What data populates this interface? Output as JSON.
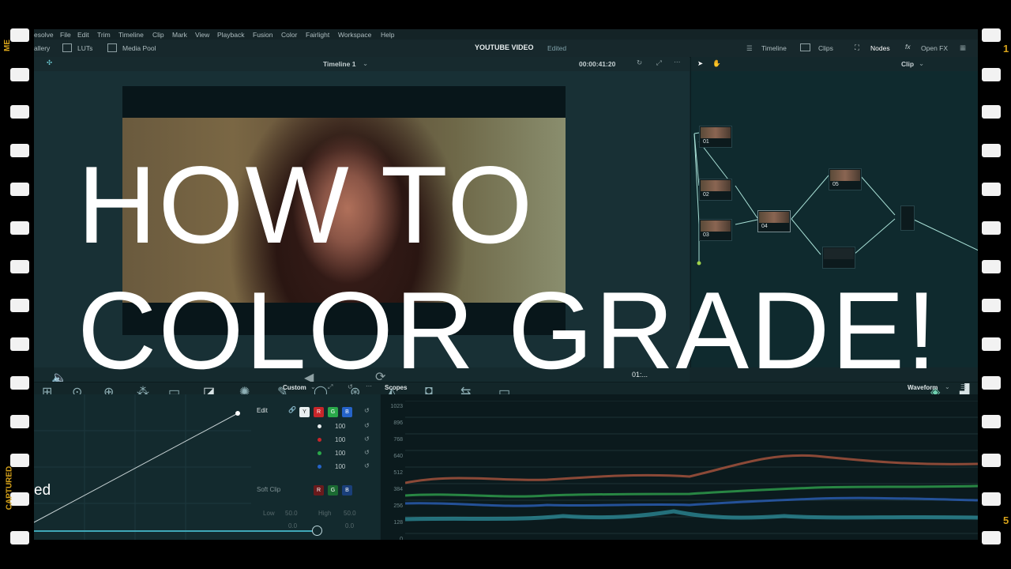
{
  "overlay": {
    "line1": "HOW TO",
    "line2": "COLOR GRADE!",
    "fragment": "ed"
  },
  "filmstrip": {
    "left_top": "ME",
    "left_bottom": "CAPTURED",
    "right_top": "1",
    "right_bottom": "5"
  },
  "menu": [
    "esolve",
    "File",
    "Edit",
    "Trim",
    "Timeline",
    "Clip",
    "Mark",
    "View",
    "Playback",
    "Fusion",
    "Color",
    "Fairlight",
    "Workspace",
    "Help"
  ],
  "toolbar": {
    "gallery": "allery",
    "luts": "LUTs",
    "media_pool": "Media Pool",
    "project_title": "YOUTUBE VIDEO",
    "project_status": "Edited",
    "timeline": "Timeline",
    "clips": "Clips",
    "nodes": "Nodes",
    "open_fx": "Open FX"
  },
  "viewer": {
    "timeline_name": "Timeline 1",
    "timecode": "00:00:41:20",
    "playhead_timecode": "01:..."
  },
  "node_editor": {
    "mode": "Clip",
    "nodes": [
      "01",
      "02",
      "03",
      "04",
      "05"
    ]
  },
  "curves": {
    "mode": "Custom",
    "edit_label": "Edit",
    "channels": [
      "Y",
      "R",
      "G",
      "B"
    ],
    "intensity_values": [
      "100",
      "100",
      "100",
      "100"
    ],
    "soft_clip_label": "Soft Clip",
    "low_label": "Low",
    "high_label": "High",
    "low_value": "50.0",
    "high_value": "50.0",
    "low_soft": "0.0",
    "high_soft": "0.0"
  },
  "scopes": {
    "title": "Scopes",
    "mode": "Waveform",
    "scale": [
      "1023",
      "896",
      "768",
      "640",
      "512",
      "384",
      "256",
      "128",
      "0"
    ]
  },
  "colors": {
    "panel": "#14272b",
    "accent_green": "#9fd24a",
    "red": "#c8262a",
    "green": "#2aa84a",
    "blue": "#2563c8"
  }
}
